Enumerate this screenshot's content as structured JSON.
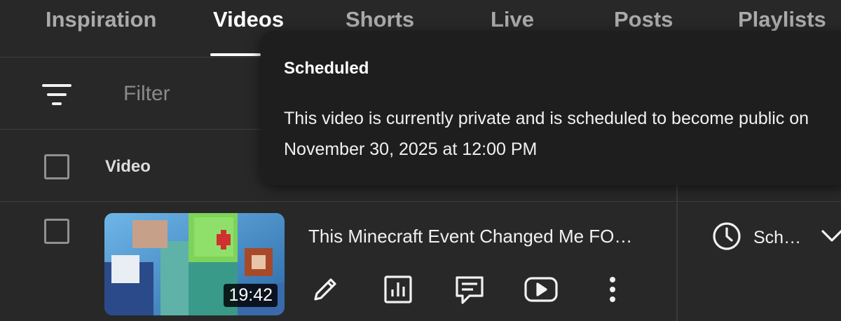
{
  "tabs": [
    {
      "label": "Inspiration",
      "active": false
    },
    {
      "label": "Videos",
      "active": true
    },
    {
      "label": "Shorts",
      "active": false
    },
    {
      "label": "Live",
      "active": false
    },
    {
      "label": "Posts",
      "active": false
    },
    {
      "label": "Playlists",
      "active": false
    }
  ],
  "filter": {
    "placeholder": "Filter",
    "icon": "filter-icon"
  },
  "table": {
    "header_video": "Video"
  },
  "video": {
    "title": "This Minecraft Event Changed Me FO…",
    "duration": "19:42",
    "visibility": "Sch…",
    "visibility_icon": "clock-icon",
    "actions": [
      "edit-icon",
      "analytics-icon",
      "comments-icon",
      "youtube-icon",
      "more-icon"
    ]
  },
  "tooltip": {
    "title": "Scheduled",
    "body": "This video is currently private and is scheduled to become public on November 30, 2025 at 12:00 PM"
  }
}
